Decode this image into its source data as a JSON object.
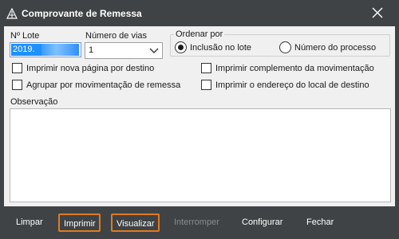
{
  "window": {
    "title": "Comprovante de Remessa",
    "icon": "app-triangle-icon",
    "close_icon": "close-icon"
  },
  "form": {
    "lote_label": "Nº Lote",
    "lote_value": "2019.",
    "vias_label": "Número de vias",
    "vias_value": "1",
    "ordenar": {
      "legend": "Ordenar por",
      "options": [
        {
          "label": "Inclusão no lote",
          "selected": true
        },
        {
          "label": "Número do processo",
          "selected": false
        }
      ]
    },
    "checkboxes": [
      {
        "label": "Imprimir nova página por destino",
        "checked": false
      },
      {
        "label": "Imprimir complemento da movimentação",
        "checked": false
      },
      {
        "label": "Agrupar por movimentação de remessa",
        "checked": false
      },
      {
        "label": "Imprimir o endereço do local de destino",
        "checked": false
      }
    ],
    "observacao_label": "Observação",
    "observacao_value": ""
  },
  "toolbar": {
    "buttons": [
      {
        "label": "Limpar",
        "enabled": true
      },
      {
        "label": "Imprimir",
        "enabled": true
      },
      {
        "label": "Visualizar",
        "enabled": true
      },
      {
        "label": "Interromper",
        "enabled": false
      },
      {
        "label": "Configurar",
        "enabled": true
      },
      {
        "label": "Fechar",
        "enabled": true
      }
    ]
  },
  "colors": {
    "title_bar": "#3f4346",
    "panel": "#f0f0f0",
    "selection": "#1e90ff",
    "highlight_border": "#e07a1f"
  }
}
